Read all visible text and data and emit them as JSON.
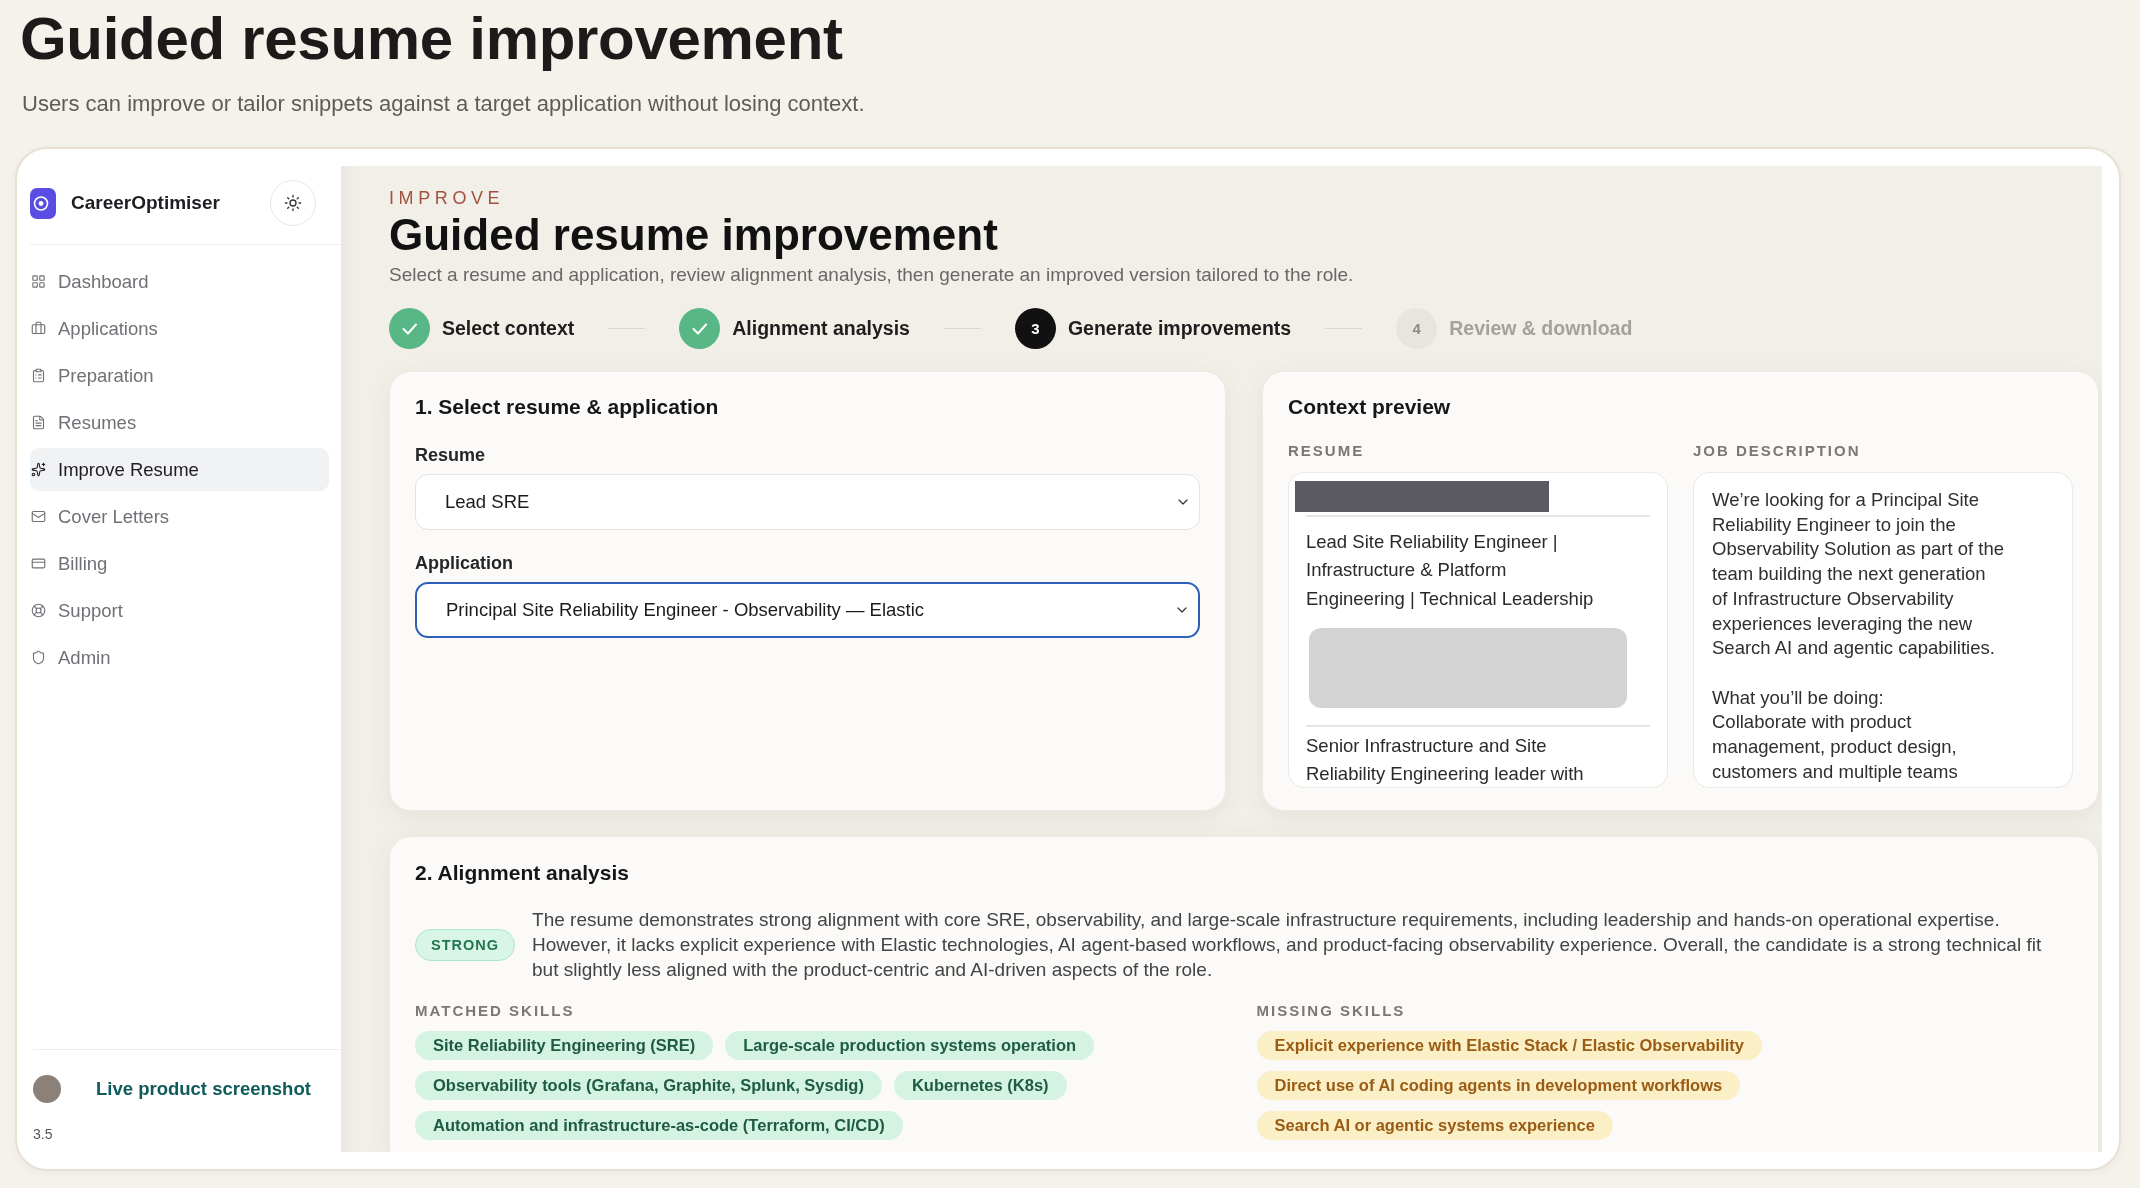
{
  "slide": {
    "title": "Guided resume improvement",
    "subtitle": "Users can improve or tailor snippets against a target application without losing context."
  },
  "sidebar": {
    "brand": "CareerOptimiser",
    "items": [
      {
        "label": "Dashboard",
        "selected": false
      },
      {
        "label": "Applications",
        "selected": false
      },
      {
        "label": "Preparation",
        "selected": false
      },
      {
        "label": "Resumes",
        "selected": false
      },
      {
        "label": "Improve Resume",
        "selected": true
      },
      {
        "label": "Cover Letters",
        "selected": false
      },
      {
        "label": "Billing",
        "selected": false
      },
      {
        "label": "Support",
        "selected": false
      },
      {
        "label": "Admin",
        "selected": false
      }
    ],
    "caption": "Live product screenshot",
    "version": "3.5"
  },
  "header": {
    "eyebrow": "IMPROVE",
    "title": "Guided resume improvement",
    "subtitle": "Select a resume and application, review alignment analysis, then generate an improved version tailored to the role."
  },
  "stepper": [
    {
      "kind": "done",
      "label": "Select context"
    },
    {
      "kind": "done",
      "label": "Alignment analysis"
    },
    {
      "kind": "current",
      "number": "3",
      "label": "Generate improvements"
    },
    {
      "kind": "upcoming",
      "number": "4",
      "label": "Review & download"
    }
  ],
  "selection": {
    "title": "1. Select resume & application",
    "fields": [
      {
        "label": "Resume",
        "value": "Lead SRE",
        "focused": false
      },
      {
        "label": "Application",
        "value": "Principal Site Reliability Engineer - Observability — Elastic",
        "focused": true
      }
    ]
  },
  "context_preview": {
    "title": "Context preview",
    "resume": {
      "label": "RESUME",
      "headline": [
        "Lead Site Reliability Engineer |",
        "Infrastructure & Platform",
        "Engineering | Technical Leadership"
      ],
      "summary": [
        "Senior Infrastructure and Site",
        "Reliability Engineering leader with"
      ]
    },
    "job_description": {
      "label": "JOB DESCRIPTION",
      "paragraphs": [
        [
          "We’re looking for a Principal Site",
          "Reliability Engineer to join the",
          "Observability Solution as part of the",
          "team building the next generation",
          "of Infrastructure Observability",
          "experiences leveraging the new",
          "Search AI and agentic capabilities."
        ],
        [
          "What you’ll be doing:",
          "Collaborate with product",
          "management, product design,",
          "customers and multiple teams"
        ]
      ]
    }
  },
  "alignment": {
    "title": "2. Alignment analysis",
    "rating": "STRONG",
    "summary": "The resume demonstrates strong alignment with core SRE, observability, and large-scale infrastructure requirements, including leadership and hands-on operational expertise. However, it lacks explicit experience with Elastic technologies, AI agent-based workflows, and product-facing observability experience. Overall, the candidate is a strong technical fit but slightly less aligned with the product-centric and AI-driven aspects of the role.",
    "skill_groups": [
      {
        "kind": "matched",
        "title": "MATCHED SKILLS",
        "skills": [
          "Site Reliability Engineering (SRE)",
          "Large-scale production systems operation",
          "Observability tools (Grafana, Graphite, Splunk, Sysdig)",
          "Kubernetes (K8s)",
          "Automation and infrastructure-as-code (Terraform, CI/CD)"
        ]
      },
      {
        "kind": "missing",
        "title": "MISSING SKILLS",
        "skills": [
          "Explicit experience with Elastic Stack / Elastic Observability",
          "Direct use of AI coding agents in development workflows",
          "Search AI or agentic systems experience"
        ]
      }
    ]
  }
}
